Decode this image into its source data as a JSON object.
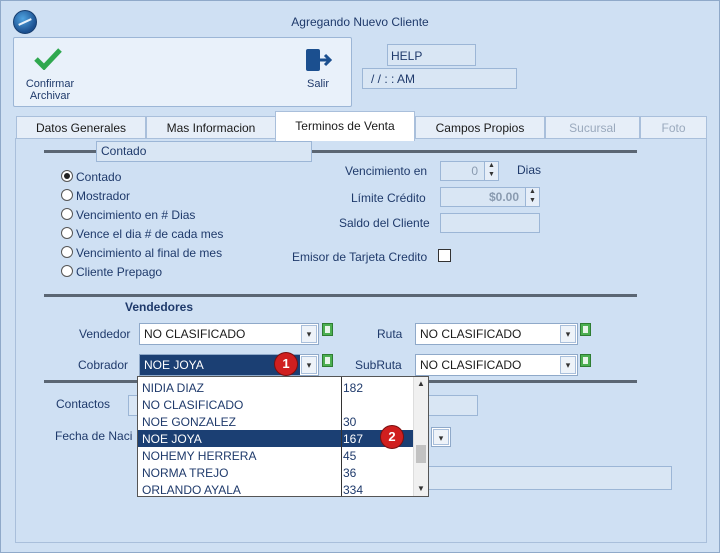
{
  "window": {
    "title": "Agregando Nuevo Cliente"
  },
  "toolbar": {
    "confirm_label_1": "Confirmar",
    "confirm_label_2": "Archivar",
    "exit_label": "Salir",
    "help_value": "HELP",
    "date_value": "/ /     :  :  AM"
  },
  "tabs": [
    "Datos Generales",
    "Mas Informacion",
    "Terminos de Venta",
    "Campos Propios",
    "Sucursal",
    "Foto"
  ],
  "terms": {
    "selected_value": "Contado",
    "options": [
      "Contado",
      "Mostrador",
      "Vencimiento en # Dias",
      "Vence el dia # de cada mes",
      "Vencimiento al final de mes",
      "Cliente Prepago"
    ],
    "due_label": "Vencimiento en",
    "due_value": "0",
    "due_unit": "Dias",
    "credit_label": "Límite Crédito",
    "credit_value": "$0.00",
    "balance_label": "Saldo del Cliente",
    "balance_value": "",
    "card_issuer_label": "Emisor de Tarjeta Credito"
  },
  "vendors": {
    "heading": "Vendedores",
    "seller_label": "Vendedor",
    "seller_value": "NO CLASIFICADO",
    "collector_label": "Cobrador",
    "collector_value": "NOE JOYA",
    "route_label": "Ruta",
    "route_value": "NO CLASIFICADO",
    "subroute_label": "SubRuta",
    "subroute_value": "NO CLASIFICADO"
  },
  "contacts": {
    "contacts_label": "Contactos",
    "birth_label": "Fecha de Naci"
  },
  "dropdown": [
    {
      "name": "NIDIA DIAZ",
      "code": "182"
    },
    {
      "name": "NO CLASIFICADO",
      "code": ""
    },
    {
      "name": "NOE GONZALEZ",
      "code": "30"
    },
    {
      "name": "NOE JOYA",
      "code": "167"
    },
    {
      "name": "NOHEMY HERRERA",
      "code": "45"
    },
    {
      "name": "NORMA TREJO",
      "code": "36"
    },
    {
      "name": "ORLANDO AYALA",
      "code": "334"
    }
  ],
  "badges": [
    "1",
    "2"
  ]
}
